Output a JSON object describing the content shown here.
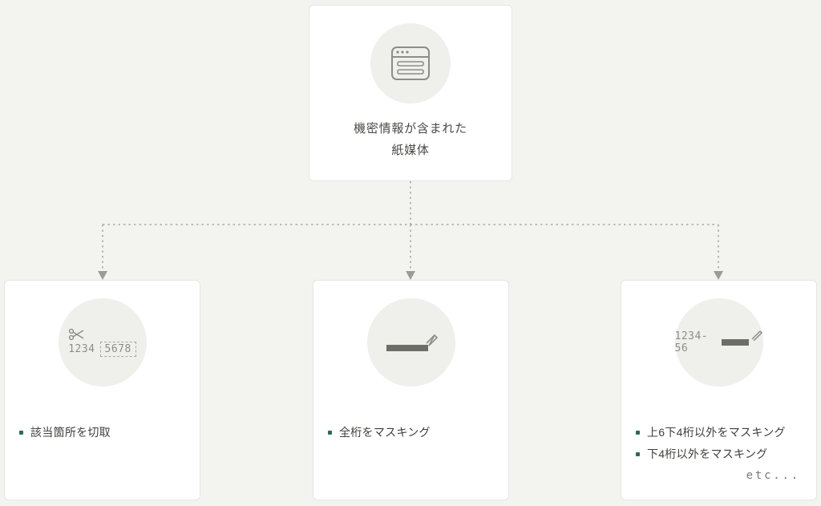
{
  "root": {
    "title_l1": "機密情報が含まれた",
    "title_l2": "紙媒体"
  },
  "children": [
    {
      "icon_left": "1234",
      "icon_right": "5678",
      "items": [
        "該当箇所を切取"
      ]
    },
    {
      "items": [
        "全桁をマスキング"
      ]
    },
    {
      "icon_text": "1234-56",
      "items": [
        "上6下4桁以外をマスキング",
        "下4桁以外をマスキング"
      ],
      "etc": "etc..."
    }
  ]
}
